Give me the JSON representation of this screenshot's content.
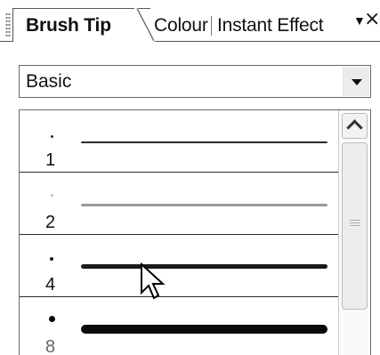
{
  "tabs": [
    {
      "label": "Brush Tip",
      "active": true
    },
    {
      "label": "Colour",
      "active": false
    },
    {
      "label": "Instant Effect",
      "active": false
    }
  ],
  "panel_controls": {
    "menu_icon": "menu-triangle-icon",
    "close_icon": "close-icon"
  },
  "preset": {
    "selected": "Basic"
  },
  "brushes": [
    {
      "label": "1",
      "preview_color": "#2a2a2a"
    },
    {
      "label": "2",
      "preview_color": "#9a9a9a"
    },
    {
      "label": "4",
      "preview_color": "#1a1a1a"
    },
    {
      "label": "8",
      "preview_color": "#0a0a0a"
    }
  ],
  "colors": {
    "border": "#6a6a6a",
    "row_divider": "#2a2a2a",
    "scrollbar": "#ededed"
  }
}
